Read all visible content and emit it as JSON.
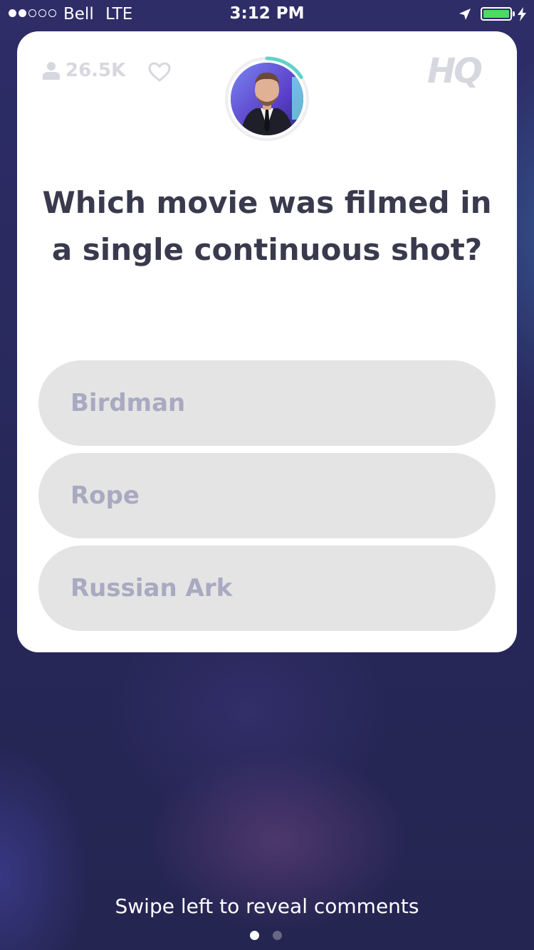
{
  "status_bar": {
    "signal_bars_filled": 2,
    "signal_bars_total": 5,
    "carrier": "Bell",
    "network": "LTE",
    "time": "3:12 PM",
    "battery_level": 1.0,
    "battery_color": "#4cd964",
    "icons": [
      "location-arrow-icon",
      "battery-icon",
      "charging-bolt-icon"
    ]
  },
  "header": {
    "viewer_count": "26.5K",
    "logo": "HQ",
    "timer_progress": 0.16,
    "timer_color": "#5fd3c8"
  },
  "question": {
    "text": "Which movie was filmed in a single continuous shot?",
    "answers": [
      {
        "label": "Birdman"
      },
      {
        "label": "Rope"
      },
      {
        "label": "Russian Ark"
      }
    ]
  },
  "footer": {
    "hint": "Swipe left to reveal comments",
    "pages": 2,
    "active_page": 0
  },
  "colors": {
    "card_bg": "#ffffff",
    "answer_bg": "#e4e4e4",
    "answer_text": "#a9a9c1",
    "question_text": "#3a3a4e",
    "muted_icon": "#d7d7df"
  }
}
